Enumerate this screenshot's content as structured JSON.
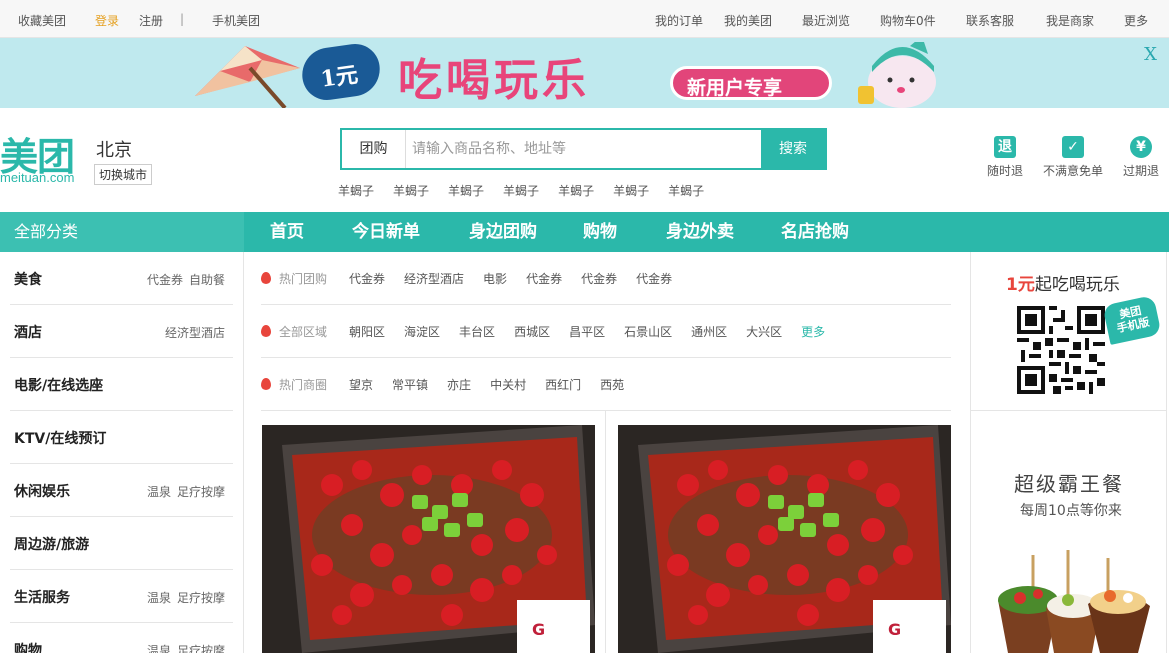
{
  "topbar": {
    "left": [
      "收藏美团",
      "登录",
      "注册",
      "|",
      "手机美团"
    ],
    "right": [
      "我的订单",
      "我的美团",
      "最近浏览",
      "购物车0件",
      "联系客服",
      "我是商家",
      "更多"
    ]
  },
  "banner": {
    "badge": "1元",
    "slogan": "吃喝玩乐",
    "pill": "新用户专享",
    "close": "X"
  },
  "logo": {
    "mark": "美团",
    "domain": "meituan.com"
  },
  "city": {
    "name": "北京",
    "switch_label": "切换城市"
  },
  "search": {
    "category": "团购",
    "placeholder": "请输入商品名称、地址等",
    "button": "搜索",
    "hotwords": [
      "羊蝎子",
      "羊蝎子",
      "羊蝎子",
      "羊蝎子",
      "羊蝎子",
      "羊蝎子",
      "羊蝎子"
    ]
  },
  "services": [
    {
      "icon": "return-anytime-icon",
      "glyph": "退",
      "label": "随时退"
    },
    {
      "icon": "checkmark-icon",
      "glyph": "✓",
      "label": "不满意免单"
    },
    {
      "icon": "expired-refund-icon",
      "glyph": "¥",
      "label": "过期退"
    }
  ],
  "nav": {
    "all_categories": "全部分类",
    "items": [
      "首页",
      "今日新单",
      "身边团购",
      "购物",
      "身边外卖",
      "名店抢购"
    ]
  },
  "sidebar": [
    {
      "name": "美食",
      "subs": [
        "代金券",
        "自助餐"
      ]
    },
    {
      "name": "酒店",
      "subs": [
        "经济型酒店"
      ]
    },
    {
      "name": "电影/在线选座",
      "subs": []
    },
    {
      "name": "KTV/在线预订",
      "subs": []
    },
    {
      "name": "休闲娱乐",
      "subs": [
        "温泉",
        "足疗按摩"
      ]
    },
    {
      "name": "周边游/旅游",
      "subs": []
    },
    {
      "name": "生活服务",
      "subs": [
        "温泉",
        "足疗按摩"
      ]
    },
    {
      "name": "购物",
      "subs": [
        "温泉",
        "足疗按摩"
      ]
    }
  ],
  "filters": [
    {
      "label": "热门团购",
      "options": [
        "代金券",
        "经济型酒店",
        "电影",
        "代金券",
        "代金券",
        "代金券"
      ],
      "more": ""
    },
    {
      "label": "全部区域",
      "options": [
        "朝阳区",
        "海淀区",
        "丰台区",
        "西城区",
        "昌平区",
        "石景山区",
        "通州区",
        "大兴区"
      ],
      "more": "更多"
    },
    {
      "label": "热门商圈",
      "options": [
        "望京",
        "常平镇",
        "亦庄",
        "中关村",
        "西红门",
        "西苑"
      ],
      "more": ""
    }
  ],
  "promo": {
    "title_prefix": "1元",
    "title_rest": "起吃喝玩乐",
    "mobile_tag_line1": "美团",
    "mobile_tag_line2": "手机版"
  },
  "bawang": {
    "title": "超级霸王餐",
    "subtitle": "每周10点等你来"
  },
  "colors": {
    "brand": "#2bb8aa",
    "accent_red": "#e8453c",
    "login": "#e5a020",
    "banner_pink": "#e8457a"
  }
}
